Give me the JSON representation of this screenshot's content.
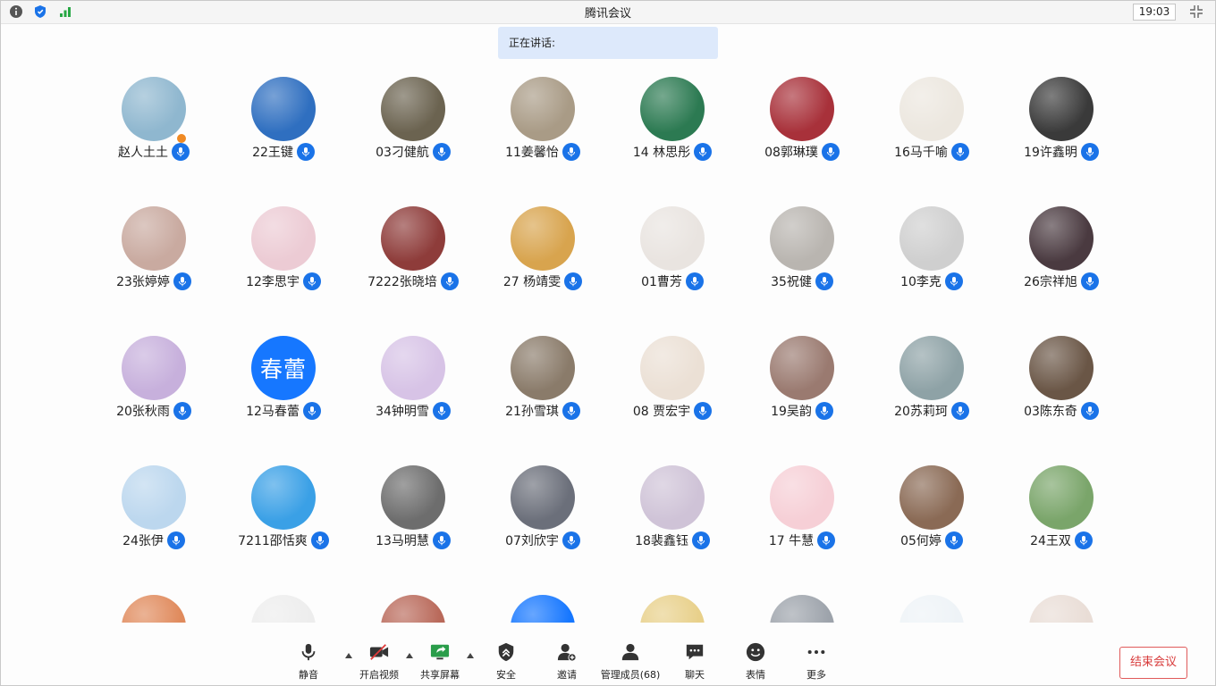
{
  "window": {
    "title": "腾讯会议",
    "clock": "19:03"
  },
  "banner": {
    "speaking_label": "正在讲话:"
  },
  "participants": [
    {
      "name": "赵人土土",
      "color": "#8fb7cf",
      "host": true
    },
    {
      "name": "22王键",
      "color": "#2f6fc0"
    },
    {
      "name": "03刁健航",
      "color": "#6b6350"
    },
    {
      "name": "11姜馨怡",
      "color": "#a99b86"
    },
    {
      "name": "14 林思彤",
      "color": "#2c7a52"
    },
    {
      "name": "08郭琳璞",
      "color": "#a8313a"
    },
    {
      "name": "16马千喻",
      "color": "#ece7df"
    },
    {
      "name": "19许鑫明",
      "color": "#3a3a3a"
    },
    {
      "name": "23张婷婷",
      "color": "#c9aaa0"
    },
    {
      "name": "12李思宇",
      "color": "#eccbd4"
    },
    {
      "name": "7222张晓培",
      "color": "#8e3c3a"
    },
    {
      "name": "27 杨靖雯",
      "color": "#d8a44e"
    },
    {
      "name": "01曹芳",
      "color": "#e9e4e0"
    },
    {
      "name": "35祝健",
      "color": "#b9b5b0"
    },
    {
      "name": "10李克",
      "color": "#cfcfcf"
    },
    {
      "name": "26宗祥旭",
      "color": "#4a3a40"
    },
    {
      "name": "20张秋雨",
      "color": "#c7b0dc"
    },
    {
      "name": "12马春蕾",
      "color": "#1677ff",
      "initials": "春蕾"
    },
    {
      "name": "34钟明雪",
      "color": "#d7c3e6"
    },
    {
      "name": "21孙雪琪",
      "color": "#8a7b6a"
    },
    {
      "name": "08 贾宏宇",
      "color": "#ebe0d5"
    },
    {
      "name": "19吴韵",
      "color": "#9a7a70"
    },
    {
      "name": "20苏莉珂",
      "color": "#8ea2a6"
    },
    {
      "name": "03陈东奇",
      "color": "#6a5646"
    },
    {
      "name": "24张伊",
      "color": "#bcd7ee"
    },
    {
      "name": "7211邵恬爽",
      "color": "#3aa0e6"
    },
    {
      "name": "13马明慧",
      "color": "#6d6d6d"
    },
    {
      "name": "07刘欣宇",
      "color": "#6b6f7a"
    },
    {
      "name": "18裴鑫钰",
      "color": "#cfc3d7"
    },
    {
      "name": "17 牛慧",
      "color": "#f6cfd6"
    },
    {
      "name": "05何婷",
      "color": "#8a6a55"
    },
    {
      "name": "24王双",
      "color": "#7aa56a"
    },
    {
      "name": "",
      "color": "#e08a5c"
    },
    {
      "name": "",
      "color": "#ededed"
    },
    {
      "name": "",
      "color": "#b9695a"
    },
    {
      "name": "",
      "color": "#1677ff"
    },
    {
      "name": "",
      "color": "#e8d08a"
    },
    {
      "name": "",
      "color": "#9da3ab"
    },
    {
      "name": "",
      "color": "#eef3f7"
    },
    {
      "name": "",
      "color": "#e9ddd6"
    }
  ],
  "toolbar": {
    "mute": "静音",
    "video": "开启视频",
    "share": "共享屏幕",
    "security": "安全",
    "invite": "邀请",
    "members": "管理成员(68)",
    "chat": "聊天",
    "emoji": "表情",
    "more": "更多",
    "end": "结束会议"
  },
  "colors": {
    "accent": "#1a73e8",
    "end_red": "#d83b3b",
    "speaking_bg": "#dde9fb",
    "host_badge": "#f08a24"
  },
  "icons": [
    "info-icon",
    "shield-icon",
    "signal-icon",
    "exit-fullscreen-icon",
    "microphone-icon",
    "video-off-icon",
    "share-screen-icon",
    "security-icon",
    "invite-icon",
    "members-icon",
    "chat-icon",
    "emoji-icon",
    "more-icon"
  ]
}
